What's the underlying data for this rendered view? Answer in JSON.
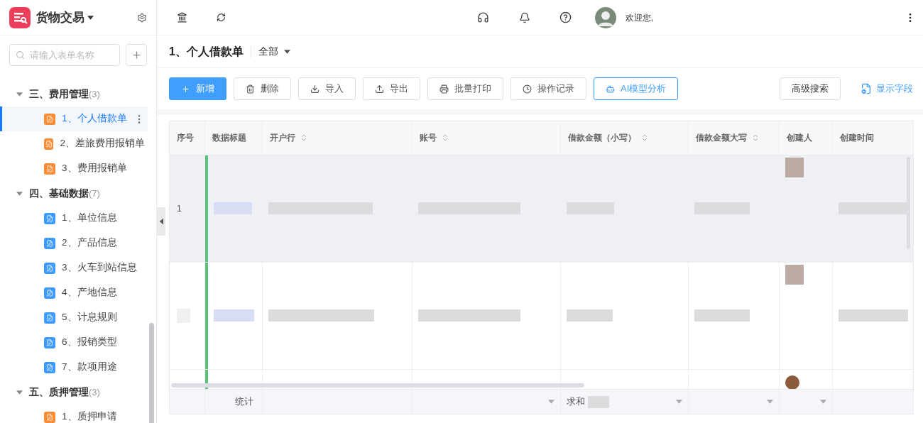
{
  "app": {
    "title": "货物交易"
  },
  "sidebar": {
    "search": {
      "placeholder": "请输入表单名称"
    },
    "groups": [
      {
        "name": "三、费用管理",
        "count": "(3)",
        "expanded": true,
        "children": [
          {
            "label": "1、个人借款单",
            "color": "#fa8c35",
            "selected": true
          },
          {
            "label": "2、差旅费用报销单",
            "color": "#fa8c35",
            "selected": false
          },
          {
            "label": "3、费用报销单",
            "color": "#fa8c35",
            "selected": false
          }
        ]
      },
      {
        "name": "四、基础数据",
        "count": "(7)",
        "expanded": true,
        "children": [
          {
            "label": "1、单位信息",
            "color": "#3d9bff",
            "selected": false
          },
          {
            "label": "2、产品信息",
            "color": "#3d9bff",
            "selected": false
          },
          {
            "label": "3、火车到站信息",
            "color": "#3d9bff",
            "selected": false
          },
          {
            "label": "4、产地信息",
            "color": "#3d9bff",
            "selected": false
          },
          {
            "label": "5、计息规则",
            "color": "#3d9bff",
            "selected": false
          },
          {
            "label": "6、报销类型",
            "color": "#3d9bff",
            "selected": false
          },
          {
            "label": "7、款项用途",
            "color": "#3d9bff",
            "selected": false
          }
        ]
      },
      {
        "name": "五、质押管理",
        "count": "(3)",
        "expanded": true,
        "children": [
          {
            "label": "1、质押申请",
            "color": "#fa8c35",
            "selected": false
          }
        ]
      }
    ]
  },
  "header": {
    "greeting": "欢迎您,"
  },
  "page": {
    "title": "1、个人借款单",
    "filter": "全部"
  },
  "toolbar": {
    "buttons": [
      {
        "label": "新增",
        "kind": "primary"
      },
      {
        "label": "删除",
        "kind": "delete"
      },
      {
        "label": "导入",
        "kind": "import"
      },
      {
        "label": "导出",
        "kind": "export"
      },
      {
        "label": "批量打印",
        "kind": "print"
      },
      {
        "label": "操作记录",
        "kind": "history"
      },
      {
        "label": "AI模型分析",
        "kind": "ai"
      }
    ],
    "advanced_search": "高级搜索",
    "show_fields": "显示字段"
  },
  "table": {
    "columns": [
      {
        "label": "序号",
        "sortable": false
      },
      {
        "label": "数据标题",
        "sortable": false
      },
      {
        "label": "开户行",
        "sortable": true
      },
      {
        "label": "账号",
        "sortable": true
      },
      {
        "label": "借款金额（小写）",
        "sortable": true
      },
      {
        "label": "借款金额大写",
        "sortable": true
      },
      {
        "label": "创建人",
        "sortable": false
      },
      {
        "label": "创建时间",
        "sortable": false
      }
    ],
    "rows": [
      {
        "index": "1",
        "highlighted": true
      },
      {
        "highlighted": false
      }
    ],
    "footer": [
      {
        "dropdown": false
      },
      {
        "text": "统计",
        "dropdown": false
      },
      {
        "dropdown": false
      },
      {
        "dropdown": true
      },
      {
        "text": "求和",
        "dropdown": true
      },
      {
        "dropdown": true
      },
      {
        "dropdown": true
      },
      {
        "dropdown": false
      }
    ]
  }
}
